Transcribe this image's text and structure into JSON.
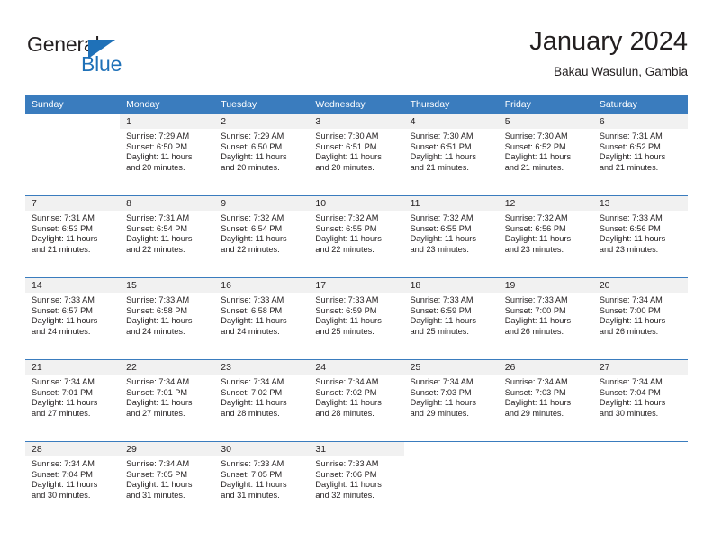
{
  "brand": {
    "name_primary": "General",
    "name_secondary": "Blue",
    "triangle_icon": "triangle-icon",
    "accent_color": "#1f71b8"
  },
  "header": {
    "title": "January 2024",
    "subtitle": "Bakau Wasulun, Gambia"
  },
  "calendar": {
    "header_color": "#3a7cbe",
    "daynum_band_color": "#f1f1f1",
    "weekday_headers": [
      "Sunday",
      "Monday",
      "Tuesday",
      "Wednesday",
      "Thursday",
      "Friday",
      "Saturday"
    ],
    "weeks": [
      [
        {
          "day": "",
          "sunrise": "",
          "sunset": "",
          "daylight_line1": "",
          "daylight_line2": ""
        },
        {
          "day": "1",
          "sunrise": "Sunrise: 7:29 AM",
          "sunset": "Sunset: 6:50 PM",
          "daylight_line1": "Daylight: 11 hours",
          "daylight_line2": "and 20 minutes."
        },
        {
          "day": "2",
          "sunrise": "Sunrise: 7:29 AM",
          "sunset": "Sunset: 6:50 PM",
          "daylight_line1": "Daylight: 11 hours",
          "daylight_line2": "and 20 minutes."
        },
        {
          "day": "3",
          "sunrise": "Sunrise: 7:30 AM",
          "sunset": "Sunset: 6:51 PM",
          "daylight_line1": "Daylight: 11 hours",
          "daylight_line2": "and 20 minutes."
        },
        {
          "day": "4",
          "sunrise": "Sunrise: 7:30 AM",
          "sunset": "Sunset: 6:51 PM",
          "daylight_line1": "Daylight: 11 hours",
          "daylight_line2": "and 21 minutes."
        },
        {
          "day": "5",
          "sunrise": "Sunrise: 7:30 AM",
          "sunset": "Sunset: 6:52 PM",
          "daylight_line1": "Daylight: 11 hours",
          "daylight_line2": "and 21 minutes."
        },
        {
          "day": "6",
          "sunrise": "Sunrise: 7:31 AM",
          "sunset": "Sunset: 6:52 PM",
          "daylight_line1": "Daylight: 11 hours",
          "daylight_line2": "and 21 minutes."
        }
      ],
      [
        {
          "day": "7",
          "sunrise": "Sunrise: 7:31 AM",
          "sunset": "Sunset: 6:53 PM",
          "daylight_line1": "Daylight: 11 hours",
          "daylight_line2": "and 21 minutes."
        },
        {
          "day": "8",
          "sunrise": "Sunrise: 7:31 AM",
          "sunset": "Sunset: 6:54 PM",
          "daylight_line1": "Daylight: 11 hours",
          "daylight_line2": "and 22 minutes."
        },
        {
          "day": "9",
          "sunrise": "Sunrise: 7:32 AM",
          "sunset": "Sunset: 6:54 PM",
          "daylight_line1": "Daylight: 11 hours",
          "daylight_line2": "and 22 minutes."
        },
        {
          "day": "10",
          "sunrise": "Sunrise: 7:32 AM",
          "sunset": "Sunset: 6:55 PM",
          "daylight_line1": "Daylight: 11 hours",
          "daylight_line2": "and 22 minutes."
        },
        {
          "day": "11",
          "sunrise": "Sunrise: 7:32 AM",
          "sunset": "Sunset: 6:55 PM",
          "daylight_line1": "Daylight: 11 hours",
          "daylight_line2": "and 23 minutes."
        },
        {
          "day": "12",
          "sunrise": "Sunrise: 7:32 AM",
          "sunset": "Sunset: 6:56 PM",
          "daylight_line1": "Daylight: 11 hours",
          "daylight_line2": "and 23 minutes."
        },
        {
          "day": "13",
          "sunrise": "Sunrise: 7:33 AM",
          "sunset": "Sunset: 6:56 PM",
          "daylight_line1": "Daylight: 11 hours",
          "daylight_line2": "and 23 minutes."
        }
      ],
      [
        {
          "day": "14",
          "sunrise": "Sunrise: 7:33 AM",
          "sunset": "Sunset: 6:57 PM",
          "daylight_line1": "Daylight: 11 hours",
          "daylight_line2": "and 24 minutes."
        },
        {
          "day": "15",
          "sunrise": "Sunrise: 7:33 AM",
          "sunset": "Sunset: 6:58 PM",
          "daylight_line1": "Daylight: 11 hours",
          "daylight_line2": "and 24 minutes."
        },
        {
          "day": "16",
          "sunrise": "Sunrise: 7:33 AM",
          "sunset": "Sunset: 6:58 PM",
          "daylight_line1": "Daylight: 11 hours",
          "daylight_line2": "and 24 minutes."
        },
        {
          "day": "17",
          "sunrise": "Sunrise: 7:33 AM",
          "sunset": "Sunset: 6:59 PM",
          "daylight_line1": "Daylight: 11 hours",
          "daylight_line2": "and 25 minutes."
        },
        {
          "day": "18",
          "sunrise": "Sunrise: 7:33 AM",
          "sunset": "Sunset: 6:59 PM",
          "daylight_line1": "Daylight: 11 hours",
          "daylight_line2": "and 25 minutes."
        },
        {
          "day": "19",
          "sunrise": "Sunrise: 7:33 AM",
          "sunset": "Sunset: 7:00 PM",
          "daylight_line1": "Daylight: 11 hours",
          "daylight_line2": "and 26 minutes."
        },
        {
          "day": "20",
          "sunrise": "Sunrise: 7:34 AM",
          "sunset": "Sunset: 7:00 PM",
          "daylight_line1": "Daylight: 11 hours",
          "daylight_line2": "and 26 minutes."
        }
      ],
      [
        {
          "day": "21",
          "sunrise": "Sunrise: 7:34 AM",
          "sunset": "Sunset: 7:01 PM",
          "daylight_line1": "Daylight: 11 hours",
          "daylight_line2": "and 27 minutes."
        },
        {
          "day": "22",
          "sunrise": "Sunrise: 7:34 AM",
          "sunset": "Sunset: 7:01 PM",
          "daylight_line1": "Daylight: 11 hours",
          "daylight_line2": "and 27 minutes."
        },
        {
          "day": "23",
          "sunrise": "Sunrise: 7:34 AM",
          "sunset": "Sunset: 7:02 PM",
          "daylight_line1": "Daylight: 11 hours",
          "daylight_line2": "and 28 minutes."
        },
        {
          "day": "24",
          "sunrise": "Sunrise: 7:34 AM",
          "sunset": "Sunset: 7:02 PM",
          "daylight_line1": "Daylight: 11 hours",
          "daylight_line2": "and 28 minutes."
        },
        {
          "day": "25",
          "sunrise": "Sunrise: 7:34 AM",
          "sunset": "Sunset: 7:03 PM",
          "daylight_line1": "Daylight: 11 hours",
          "daylight_line2": "and 29 minutes."
        },
        {
          "day": "26",
          "sunrise": "Sunrise: 7:34 AM",
          "sunset": "Sunset: 7:03 PM",
          "daylight_line1": "Daylight: 11 hours",
          "daylight_line2": "and 29 minutes."
        },
        {
          "day": "27",
          "sunrise": "Sunrise: 7:34 AM",
          "sunset": "Sunset: 7:04 PM",
          "daylight_line1": "Daylight: 11 hours",
          "daylight_line2": "and 30 minutes."
        }
      ],
      [
        {
          "day": "28",
          "sunrise": "Sunrise: 7:34 AM",
          "sunset": "Sunset: 7:04 PM",
          "daylight_line1": "Daylight: 11 hours",
          "daylight_line2": "and 30 minutes."
        },
        {
          "day": "29",
          "sunrise": "Sunrise: 7:34 AM",
          "sunset": "Sunset: 7:05 PM",
          "daylight_line1": "Daylight: 11 hours",
          "daylight_line2": "and 31 minutes."
        },
        {
          "day": "30",
          "sunrise": "Sunrise: 7:33 AM",
          "sunset": "Sunset: 7:05 PM",
          "daylight_line1": "Daylight: 11 hours",
          "daylight_line2": "and 31 minutes."
        },
        {
          "day": "31",
          "sunrise": "Sunrise: 7:33 AM",
          "sunset": "Sunset: 7:06 PM",
          "daylight_line1": "Daylight: 11 hours",
          "daylight_line2": "and 32 minutes."
        },
        {
          "day": "",
          "sunrise": "",
          "sunset": "",
          "daylight_line1": "",
          "daylight_line2": ""
        },
        {
          "day": "",
          "sunrise": "",
          "sunset": "",
          "daylight_line1": "",
          "daylight_line2": ""
        },
        {
          "day": "",
          "sunrise": "",
          "sunset": "",
          "daylight_line1": "",
          "daylight_line2": ""
        }
      ]
    ]
  }
}
